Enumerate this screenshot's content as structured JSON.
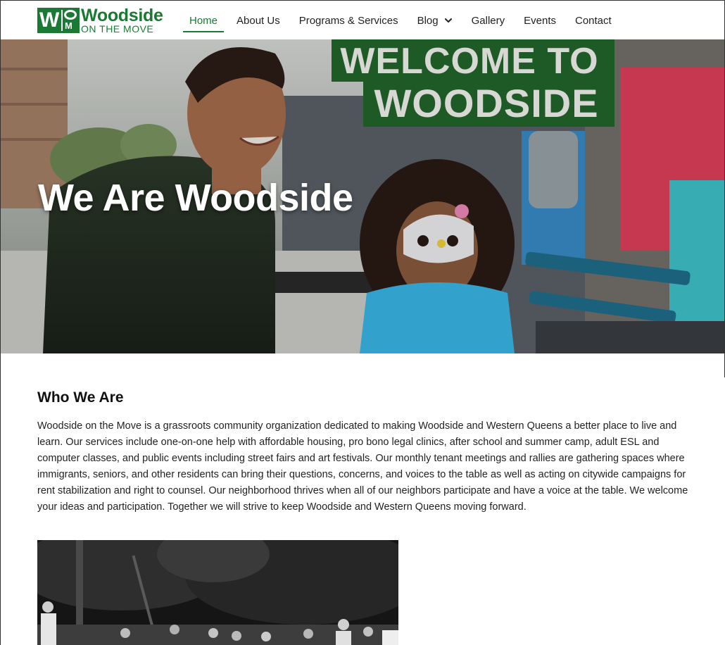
{
  "site": {
    "logo": {
      "mark_letters": "W",
      "mark_sub": "M",
      "line1": "Woodside",
      "line2": "ON THE MOVE",
      "brand_color": "#1a7a33"
    }
  },
  "nav": {
    "items": [
      {
        "label": "Home",
        "active": true
      },
      {
        "label": "About Us",
        "active": false
      },
      {
        "label": "Programs & Services",
        "active": false
      },
      {
        "label": "Blog",
        "active": false,
        "has_dropdown": true,
        "icon": "chevron-down-icon"
      },
      {
        "label": "Gallery",
        "active": false
      },
      {
        "label": "Events",
        "active": false
      },
      {
        "label": "Contact",
        "active": false
      }
    ]
  },
  "hero": {
    "title": "We Are Woodside",
    "sign_line1": "WELCOME TO",
    "sign_line2": "WOODSIDE",
    "sign_color": "#1e5a26"
  },
  "who_we_are": {
    "heading": "Who We Are",
    "body": "Woodside on the Move is a grassroots community organization dedicated to making Woodside and Western Queens a better place to live and learn. Our services include one-on-one help with affordable housing, pro bono legal clinics, after school and summer camp, adult ESL and computer classes, and public events including street fairs and art festivals. Our monthly tenant meetings and rallies are gathering spaces where immigrants, seniors, and other residents can bring their questions, concerns, and voices to the table as well as acting on citywide campaigns for rent stabilization and right to counsel. Our neighborhood thrives when all of our neighbors participate and have a voice at the table. We welcome your ideas and participation. Together we will strive to keep Woodside and Western Queens moving forward."
  }
}
